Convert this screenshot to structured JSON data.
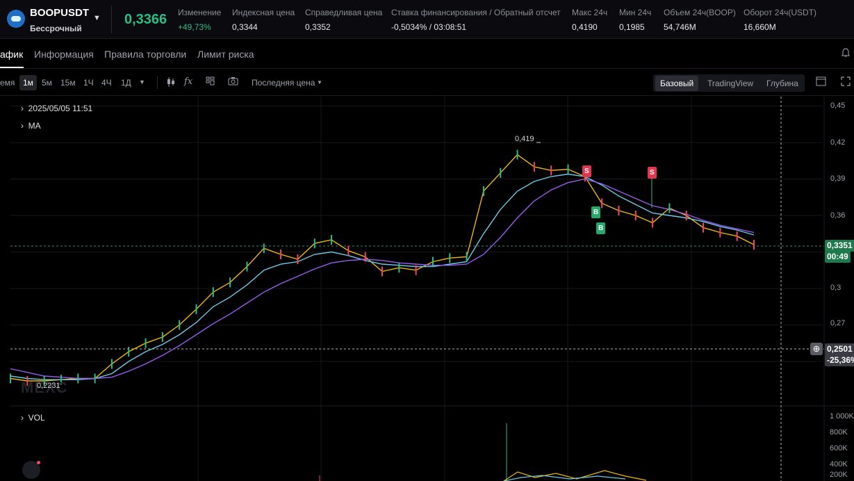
{
  "header": {
    "symbol": "BOOPUSDT",
    "contract_type": "Бессрочный",
    "last_price": "0,3366",
    "stats": [
      {
        "label": "Изменение",
        "value": "+49,73%"
      },
      {
        "label": "Индексная цена",
        "value": "0,3344"
      },
      {
        "label": "Справедливая цена",
        "value": "0,3352"
      },
      {
        "label": "Ставка финансирования / Обратный отсчет",
        "value": "-0,5034% / 03:08:51"
      },
      {
        "label": "Макс 24ч",
        "value": "0,4190"
      },
      {
        "label": "Мин 24ч",
        "value": "0,1985"
      },
      {
        "label": "Объем 24ч(BOOP)",
        "value": "54,746M"
      },
      {
        "label": "Оборот 24ч(USDT)",
        "value": "16,660M"
      }
    ],
    "colors": {
      "up": "#2ebd85",
      "down": "#f6465d"
    }
  },
  "tabs": {
    "items": [
      "афик",
      "Информация",
      "Правила торговли",
      "Лимит риска"
    ],
    "active": "афик"
  },
  "toolbar": {
    "intervals": [
      "емя",
      "1м",
      "5м",
      "15м",
      "1Ч",
      "4Ч",
      "1Д"
    ],
    "active_interval": "1м",
    "price_type": "Последняя цена",
    "views": [
      "Базовый",
      "TradingView",
      "Глубина"
    ],
    "active_view": "Базовый",
    "icons": [
      "chevron-down-icon",
      "candles-icon",
      "fx-icon",
      "layout-icon",
      "camera-icon",
      "caret-down-icon",
      "fullscreen-icon",
      "expand-icon"
    ]
  },
  "chart": {
    "legend_datetime": "2025/05/05 11:51",
    "legend_ma": "MA",
    "legend_vol": "VOL",
    "watermark": "MEXC",
    "price_ticks": [
      "0,45",
      "0,42",
      "0,39",
      "0,36",
      "0,3",
      "0,27"
    ],
    "volume_ticks": [
      "1 000K",
      "800K",
      "600K",
      "400K",
      "200K"
    ],
    "high_label": "0,419",
    "low_label": "0,2231",
    "current_price_tag": "0,3351",
    "countdown_tag": "00:49",
    "crosshair_price_tag": "0,2501",
    "crosshair_pct_tag": "-25,36%",
    "trade_markers": [
      "S",
      "S",
      "B",
      "B"
    ]
  },
  "chart_data": {
    "type": "line",
    "title": "",
    "xlabel": "",
    "ylabel": "",
    "ylim": [
      0.2,
      0.45
    ],
    "series": [
      {
        "name": "",
        "values": [
          0.226,
          0.224,
          0.224,
          0.225,
          0.226,
          0.226,
          0.238,
          0.248,
          0.255,
          0.26,
          0.27,
          0.283,
          0.297,
          0.305,
          0.318,
          0.333,
          0.328,
          0.324,
          0.337,
          0.34,
          0.331,
          0.326,
          0.314,
          0.317,
          0.315,
          0.322,
          0.325,
          0.326,
          0.38,
          0.395,
          0.41,
          0.4,
          0.397,
          0.398,
          0.392,
          0.37,
          0.364,
          0.36,
          0.354,
          0.366,
          0.36,
          0.35,
          0.346,
          0.343,
          0.336
        ]
      },
      {
        "name": "",
        "values": [
          0.228,
          0.226,
          0.225,
          0.225,
          0.225,
          0.226,
          0.23,
          0.24,
          0.248,
          0.254,
          0.262,
          0.272,
          0.285,
          0.293,
          0.303,
          0.315,
          0.32,
          0.322,
          0.328,
          0.33,
          0.327,
          0.323,
          0.32,
          0.319,
          0.318,
          0.318,
          0.32,
          0.322,
          0.345,
          0.365,
          0.38,
          0.388,
          0.392,
          0.394,
          0.392,
          0.385,
          0.376,
          0.369,
          0.362,
          0.36,
          0.358,
          0.355,
          0.351,
          0.348,
          0.344
        ]
      },
      {
        "name": "",
        "values": [
          0.234,
          0.231,
          0.228,
          0.227,
          0.226,
          0.226,
          0.227,
          0.232,
          0.238,
          0.245,
          0.253,
          0.262,
          0.271,
          0.279,
          0.288,
          0.297,
          0.304,
          0.31,
          0.316,
          0.321,
          0.323,
          0.324,
          0.323,
          0.321,
          0.32,
          0.319,
          0.319,
          0.32,
          0.328,
          0.342,
          0.358,
          0.372,
          0.381,
          0.387,
          0.39,
          0.386,
          0.38,
          0.374,
          0.368,
          0.365,
          0.361,
          0.356,
          0.352,
          0.349,
          0.346
        ]
      }
    ]
  }
}
